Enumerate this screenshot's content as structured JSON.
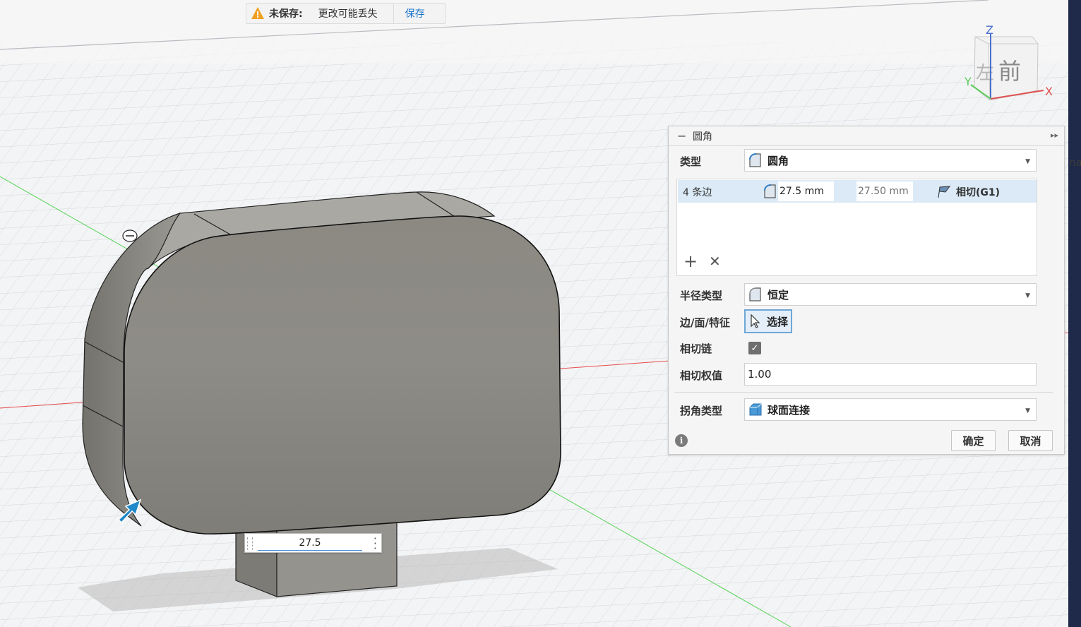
{
  "banner": {
    "warning_icon": "warning-triangle-icon",
    "status": "未保存:",
    "message": "更改可能丢失",
    "save_link": "保存"
  },
  "viewcube": {
    "face_front": "前",
    "face_left": "左",
    "axis_z": "Z",
    "axis_x": "X",
    "axis_y": "Y"
  },
  "panel": {
    "title": "圆角",
    "type": {
      "label": "类型",
      "value": "圆角"
    },
    "edges": {
      "count": "4 条边",
      "radius": "27.5 mm",
      "radius_placeholder": "27.50 mm",
      "tangency": "相切(G1)"
    },
    "radius_type": {
      "label": "半径类型",
      "value": "恒定"
    },
    "selection": {
      "label": "边/面/特征",
      "button": "选择"
    },
    "tangent_chain": {
      "label": "相切链",
      "checked": true
    },
    "tangent_weight": {
      "label": "相切权值",
      "value": "1.00"
    },
    "corner_type": {
      "label": "拐角类型",
      "value": "球面连接"
    },
    "ok": "确定",
    "cancel": "取消"
  },
  "dimension_input": {
    "value": "27.5"
  },
  "right_edge_text": "na",
  "colors": {
    "model_fill": "#8e8c86",
    "model_top": "#aeaca6",
    "accent_blue": "#1a73c9",
    "axis_red": "#e84c4c",
    "axis_green": "#55d455",
    "grid": "#d3d6da"
  }
}
